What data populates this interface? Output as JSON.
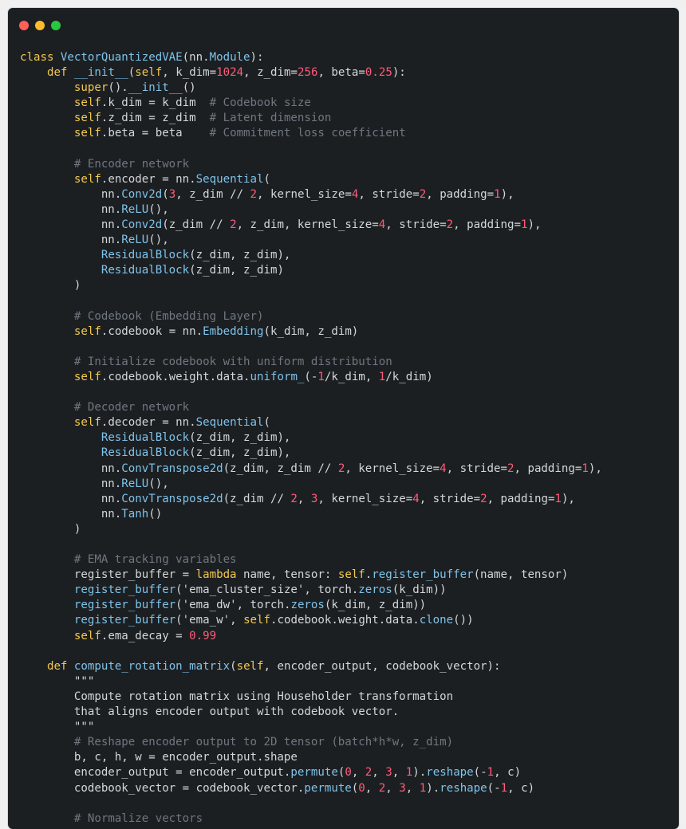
{
  "window": {
    "controls": [
      "close",
      "minimize",
      "maximize"
    ],
    "colors": {
      "background": "#1c1f22",
      "keyword": "#f2c94c",
      "function": "#7ec3ea",
      "number": "#ff5c7a",
      "comment": "#6f7780",
      "text": "#d4d7da"
    }
  },
  "code_lines": [
    [
      [
        "kw",
        "class "
      ],
      [
        "cls",
        "VectorQuantizedVAE"
      ],
      [
        "plain",
        "(nn."
      ],
      [
        "cls",
        "Module"
      ],
      [
        "plain",
        "):"
      ]
    ],
    [
      [
        "plain",
        "    "
      ],
      [
        "kw",
        "def "
      ],
      [
        "fn",
        "__init__"
      ],
      [
        "plain",
        "("
      ],
      [
        "self",
        "self"
      ],
      [
        "plain",
        ", k_dim="
      ],
      [
        "num",
        "1024"
      ],
      [
        "plain",
        ", z_dim="
      ],
      [
        "num",
        "256"
      ],
      [
        "plain",
        ", beta="
      ],
      [
        "num",
        "0.25"
      ],
      [
        "plain",
        "):"
      ]
    ],
    [
      [
        "plain",
        "        "
      ],
      [
        "kw",
        "super"
      ],
      [
        "plain",
        "()."
      ],
      [
        "fn",
        "__init__"
      ],
      [
        "plain",
        "()"
      ]
    ],
    [
      [
        "plain",
        "        "
      ],
      [
        "self",
        "self"
      ],
      [
        "plain",
        ".k_dim = k_dim  "
      ],
      [
        "cm",
        "# Codebook size"
      ]
    ],
    [
      [
        "plain",
        "        "
      ],
      [
        "self",
        "self"
      ],
      [
        "plain",
        ".z_dim = z_dim  "
      ],
      [
        "cm",
        "# Latent dimension"
      ]
    ],
    [
      [
        "plain",
        "        "
      ],
      [
        "self",
        "self"
      ],
      [
        "plain",
        ".beta = beta    "
      ],
      [
        "cm",
        "# Commitment loss coefficient"
      ]
    ],
    [
      [
        "plain",
        ""
      ]
    ],
    [
      [
        "plain",
        "        "
      ],
      [
        "cm",
        "# Encoder network"
      ]
    ],
    [
      [
        "plain",
        "        "
      ],
      [
        "self",
        "self"
      ],
      [
        "plain",
        ".encoder = nn."
      ],
      [
        "fn",
        "Sequential"
      ],
      [
        "plain",
        "("
      ]
    ],
    [
      [
        "plain",
        "            nn."
      ],
      [
        "fn",
        "Conv2d"
      ],
      [
        "plain",
        "("
      ],
      [
        "num",
        "3"
      ],
      [
        "plain",
        ", z_dim // "
      ],
      [
        "num",
        "2"
      ],
      [
        "plain",
        ", kernel_size="
      ],
      [
        "num",
        "4"
      ],
      [
        "plain",
        ", stride="
      ],
      [
        "num",
        "2"
      ],
      [
        "plain",
        ", padding="
      ],
      [
        "num",
        "1"
      ],
      [
        "plain",
        "),"
      ]
    ],
    [
      [
        "plain",
        "            nn."
      ],
      [
        "fn",
        "ReLU"
      ],
      [
        "plain",
        "(),"
      ]
    ],
    [
      [
        "plain",
        "            nn."
      ],
      [
        "fn",
        "Conv2d"
      ],
      [
        "plain",
        "(z_dim // "
      ],
      [
        "num",
        "2"
      ],
      [
        "plain",
        ", z_dim, kernel_size="
      ],
      [
        "num",
        "4"
      ],
      [
        "plain",
        ", stride="
      ],
      [
        "num",
        "2"
      ],
      [
        "plain",
        ", padding="
      ],
      [
        "num",
        "1"
      ],
      [
        "plain",
        "),"
      ]
    ],
    [
      [
        "plain",
        "            nn."
      ],
      [
        "fn",
        "ReLU"
      ],
      [
        "plain",
        "(),"
      ]
    ],
    [
      [
        "plain",
        "            "
      ],
      [
        "fn",
        "ResidualBlock"
      ],
      [
        "plain",
        "(z_dim, z_dim),"
      ]
    ],
    [
      [
        "plain",
        "            "
      ],
      [
        "fn",
        "ResidualBlock"
      ],
      [
        "plain",
        "(z_dim, z_dim)"
      ]
    ],
    [
      [
        "plain",
        "        )"
      ]
    ],
    [
      [
        "plain",
        ""
      ]
    ],
    [
      [
        "plain",
        "        "
      ],
      [
        "cm",
        "# Codebook (Embedding Layer)"
      ]
    ],
    [
      [
        "plain",
        "        "
      ],
      [
        "self",
        "self"
      ],
      [
        "plain",
        ".codebook = nn."
      ],
      [
        "fn",
        "Embedding"
      ],
      [
        "plain",
        "(k_dim, z_dim)"
      ]
    ],
    [
      [
        "plain",
        ""
      ]
    ],
    [
      [
        "plain",
        "        "
      ],
      [
        "cm",
        "# Initialize codebook with uniform distribution"
      ]
    ],
    [
      [
        "plain",
        "        "
      ],
      [
        "self",
        "self"
      ],
      [
        "plain",
        ".codebook.weight.data."
      ],
      [
        "fn",
        "uniform_"
      ],
      [
        "plain",
        "(-"
      ],
      [
        "num",
        "1"
      ],
      [
        "plain",
        "/k_dim, "
      ],
      [
        "num",
        "1"
      ],
      [
        "plain",
        "/k_dim)"
      ]
    ],
    [
      [
        "plain",
        ""
      ]
    ],
    [
      [
        "plain",
        "        "
      ],
      [
        "cm",
        "# Decoder network"
      ]
    ],
    [
      [
        "plain",
        "        "
      ],
      [
        "self",
        "self"
      ],
      [
        "plain",
        ".decoder = nn."
      ],
      [
        "fn",
        "Sequential"
      ],
      [
        "plain",
        "("
      ]
    ],
    [
      [
        "plain",
        "            "
      ],
      [
        "fn",
        "ResidualBlock"
      ],
      [
        "plain",
        "(z_dim, z_dim),"
      ]
    ],
    [
      [
        "plain",
        "            "
      ],
      [
        "fn",
        "ResidualBlock"
      ],
      [
        "plain",
        "(z_dim, z_dim),"
      ]
    ],
    [
      [
        "plain",
        "            nn."
      ],
      [
        "fn",
        "ConvTranspose2d"
      ],
      [
        "plain",
        "(z_dim, z_dim // "
      ],
      [
        "num",
        "2"
      ],
      [
        "plain",
        ", kernel_size="
      ],
      [
        "num",
        "4"
      ],
      [
        "plain",
        ", stride="
      ],
      [
        "num",
        "2"
      ],
      [
        "plain",
        ", padding="
      ],
      [
        "num",
        "1"
      ],
      [
        "plain",
        "),"
      ]
    ],
    [
      [
        "plain",
        "            nn."
      ],
      [
        "fn",
        "ReLU"
      ],
      [
        "plain",
        "(),"
      ]
    ],
    [
      [
        "plain",
        "            nn."
      ],
      [
        "fn",
        "ConvTranspose2d"
      ],
      [
        "plain",
        "(z_dim // "
      ],
      [
        "num",
        "2"
      ],
      [
        "plain",
        ", "
      ],
      [
        "num",
        "3"
      ],
      [
        "plain",
        ", kernel_size="
      ],
      [
        "num",
        "4"
      ],
      [
        "plain",
        ", stride="
      ],
      [
        "num",
        "2"
      ],
      [
        "plain",
        ", padding="
      ],
      [
        "num",
        "1"
      ],
      [
        "plain",
        "),"
      ]
    ],
    [
      [
        "plain",
        "            nn."
      ],
      [
        "fn",
        "Tanh"
      ],
      [
        "plain",
        "()"
      ]
    ],
    [
      [
        "plain",
        "        )"
      ]
    ],
    [
      [
        "plain",
        ""
      ]
    ],
    [
      [
        "plain",
        "        "
      ],
      [
        "cm",
        "# EMA tracking variables"
      ]
    ],
    [
      [
        "plain",
        "        register_buffer = "
      ],
      [
        "kw",
        "lambda"
      ],
      [
        "plain",
        " name, tensor: "
      ],
      [
        "self",
        "self"
      ],
      [
        "plain",
        "."
      ],
      [
        "fn",
        "register_buffer"
      ],
      [
        "plain",
        "(name, tensor)"
      ]
    ],
    [
      [
        "plain",
        "        "
      ],
      [
        "fn",
        "register_buffer"
      ],
      [
        "plain",
        "("
      ],
      [
        "str",
        "'ema_cluster_size'"
      ],
      [
        "plain",
        ", torch."
      ],
      [
        "fn",
        "zeros"
      ],
      [
        "plain",
        "(k_dim))"
      ]
    ],
    [
      [
        "plain",
        "        "
      ],
      [
        "fn",
        "register_buffer"
      ],
      [
        "plain",
        "("
      ],
      [
        "str",
        "'ema_dw'"
      ],
      [
        "plain",
        ", torch."
      ],
      [
        "fn",
        "zeros"
      ],
      [
        "plain",
        "(k_dim, z_dim))"
      ]
    ],
    [
      [
        "plain",
        "        "
      ],
      [
        "fn",
        "register_buffer"
      ],
      [
        "plain",
        "("
      ],
      [
        "str",
        "'ema_w'"
      ],
      [
        "plain",
        ", "
      ],
      [
        "self",
        "self"
      ],
      [
        "plain",
        ".codebook.weight.data."
      ],
      [
        "fn",
        "clone"
      ],
      [
        "plain",
        "())"
      ]
    ],
    [
      [
        "plain",
        "        "
      ],
      [
        "self",
        "self"
      ],
      [
        "plain",
        ".ema_decay = "
      ],
      [
        "num",
        "0.99"
      ]
    ],
    [
      [
        "plain",
        ""
      ]
    ],
    [
      [
        "plain",
        "    "
      ],
      [
        "kw",
        "def "
      ],
      [
        "fn",
        "compute_rotation_matrix"
      ],
      [
        "plain",
        "("
      ],
      [
        "self",
        "self"
      ],
      [
        "plain",
        ", encoder_output, codebook_vector):"
      ]
    ],
    [
      [
        "plain",
        "        \"\"\""
      ]
    ],
    [
      [
        "plain",
        "        Compute rotation matrix using Householder transformation"
      ]
    ],
    [
      [
        "plain",
        "        that aligns encoder output with codebook vector."
      ]
    ],
    [
      [
        "plain",
        "        \"\"\""
      ]
    ],
    [
      [
        "plain",
        "        "
      ],
      [
        "cm",
        "# Reshape encoder output to 2D tensor (batch*h*w, z_dim)"
      ]
    ],
    [
      [
        "plain",
        "        b, c, h, w = encoder_output.shape"
      ]
    ],
    [
      [
        "plain",
        "        encoder_output = encoder_output."
      ],
      [
        "fn",
        "permute"
      ],
      [
        "plain",
        "("
      ],
      [
        "num",
        "0"
      ],
      [
        "plain",
        ", "
      ],
      [
        "num",
        "2"
      ],
      [
        "plain",
        ", "
      ],
      [
        "num",
        "3"
      ],
      [
        "plain",
        ", "
      ],
      [
        "num",
        "1"
      ],
      [
        "plain",
        ")."
      ],
      [
        "fn",
        "reshape"
      ],
      [
        "plain",
        "(-"
      ],
      [
        "num",
        "1"
      ],
      [
        "plain",
        ", c)"
      ]
    ],
    [
      [
        "plain",
        "        codebook_vector = codebook_vector."
      ],
      [
        "fn",
        "permute"
      ],
      [
        "plain",
        "("
      ],
      [
        "num",
        "0"
      ],
      [
        "plain",
        ", "
      ],
      [
        "num",
        "2"
      ],
      [
        "plain",
        ", "
      ],
      [
        "num",
        "3"
      ],
      [
        "plain",
        ", "
      ],
      [
        "num",
        "1"
      ],
      [
        "plain",
        ")."
      ],
      [
        "fn",
        "reshape"
      ],
      [
        "plain",
        "(-"
      ],
      [
        "num",
        "1"
      ],
      [
        "plain",
        ", c)"
      ]
    ],
    [
      [
        "plain",
        ""
      ]
    ],
    [
      [
        "plain",
        "        "
      ],
      [
        "cm",
        "# Normalize vectors"
      ]
    ]
  ]
}
